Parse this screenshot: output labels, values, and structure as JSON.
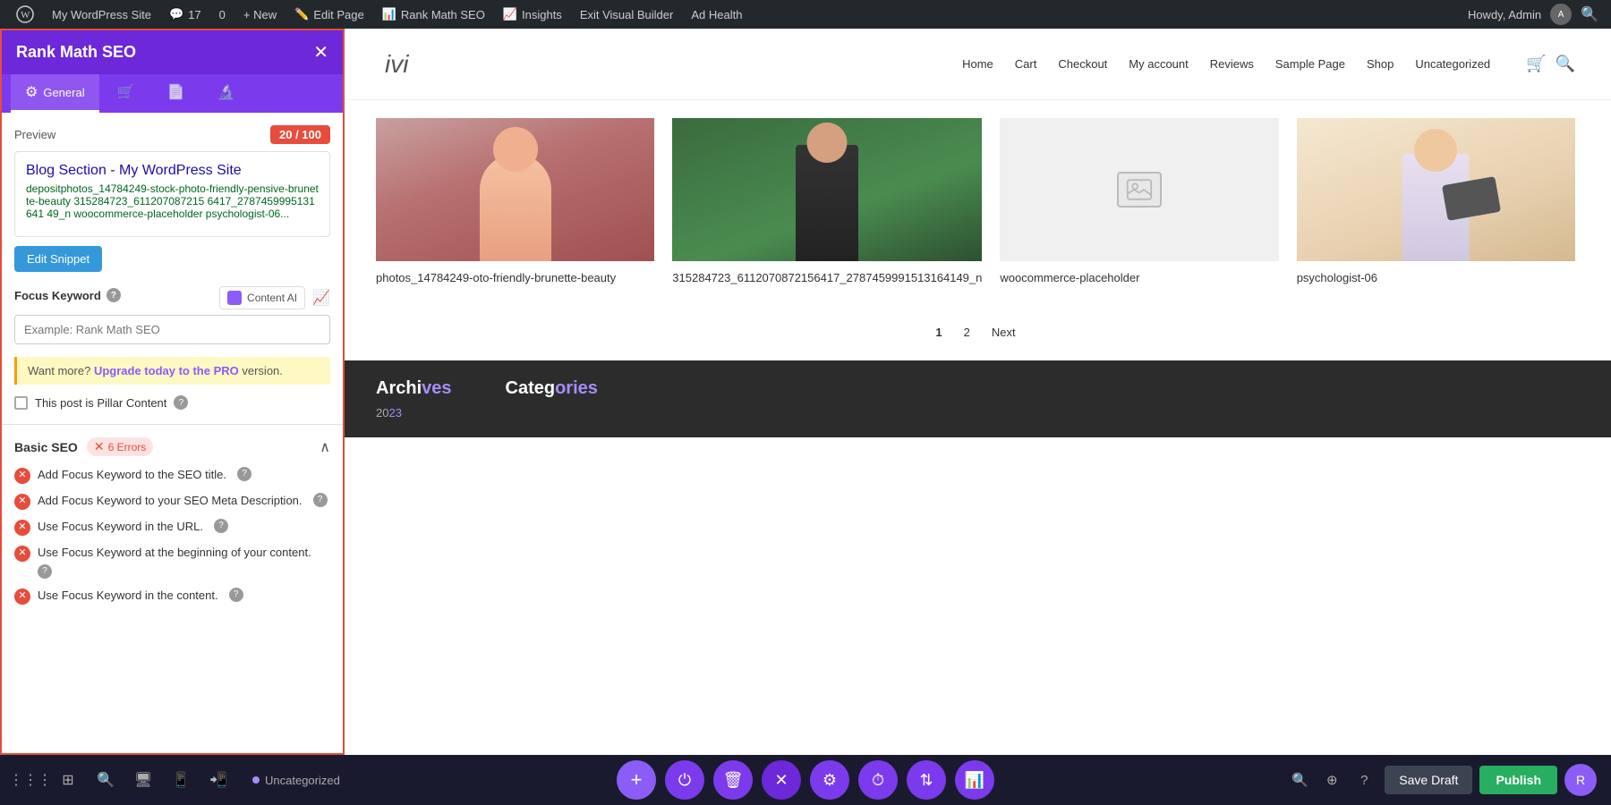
{
  "adminBar": {
    "siteName": "My WordPress Site",
    "commentCount": "17",
    "updates": "0",
    "newLabel": "+ New",
    "editPage": "Edit Page",
    "rankMath": "Rank Math SEO",
    "insights": "Insights",
    "exitBuilder": "Exit Visual Builder",
    "adHealth": "Ad Health",
    "howdy": "Howdy, Admin"
  },
  "siteHeader": {
    "logo": "ivi",
    "nav": [
      "Home",
      "Cart",
      "Checkout",
      "My account",
      "Reviews",
      "Sample Page",
      "Shop",
      "Uncategorized"
    ]
  },
  "blogCards": [
    {
      "title": "photos_14784249-oto-friendly-brunette-beauty",
      "imgType": "person"
    },
    {
      "title": "315284723_611207087215 6417_2787459991513164149_n",
      "imgType": "person-dark"
    },
    {
      "title": "woocommerce-placeholder",
      "imgType": "placeholder"
    },
    {
      "title": "psychologist-06",
      "imgType": "blonde"
    }
  ],
  "pagination": {
    "items": [
      "1",
      "2",
      "Next"
    ]
  },
  "sections": {
    "archives": "ves",
    "archivesYear": "023",
    "categories": "ories"
  },
  "bottomToolbar": {
    "uncategorized": "Uncategorized",
    "saveDraft": "Save Draft",
    "publish": "Publish",
    "floatingButtons": [
      {
        "icon": "+",
        "type": "add"
      },
      {
        "icon": "⏻",
        "type": "power"
      },
      {
        "icon": "🗑",
        "type": "trash"
      },
      {
        "icon": "✕",
        "type": "close"
      },
      {
        "icon": "⚙",
        "type": "settings"
      },
      {
        "icon": "⏱",
        "type": "clock"
      },
      {
        "icon": "⇅",
        "type": "arrows"
      },
      {
        "icon": "📊",
        "type": "chart"
      }
    ]
  },
  "rankMathPanel": {
    "title": "Rank Math SEO",
    "tabs": [
      {
        "label": "General",
        "icon": "⚙",
        "active": true
      },
      {
        "label": "",
        "icon": "🛒"
      },
      {
        "label": "",
        "icon": "📄"
      },
      {
        "label": "",
        "icon": "🔬"
      }
    ],
    "preview": {
      "label": "Preview",
      "score": "20 / 100",
      "title": "Blog Section - My WordPress Site",
      "url": "depositphotos_14784249-stock-photo-friendly-pensive-brunette-beauty 315284723_611207087215 6417_2787459995131641 49_n woocommerce-placeholder psychologist-06...",
      "description": "",
      "editSnippetBtn": "Edit Snippet"
    },
    "focusKeyword": {
      "label": "Focus Keyword",
      "placeholder": "Example: Rank Math SEO",
      "contentAIBtn": "Content AI",
      "helpText": "?"
    },
    "upgradeBanner": {
      "text": "Want more?",
      "linkText": "Upgrade today to the PRO",
      "suffix": "version."
    },
    "pillarContent": {
      "label": "This post is Pillar Content"
    },
    "basicSEO": {
      "label": "Basic SEO",
      "errorsCount": "6 Errors",
      "checks": [
        "Add Focus Keyword to the SEO title.",
        "Add Focus Keyword to your SEO Meta Description.",
        "Use Focus Keyword in the URL.",
        "Use Focus Keyword at the beginning of your content.",
        "Use Focus Keyword in the content."
      ]
    }
  }
}
